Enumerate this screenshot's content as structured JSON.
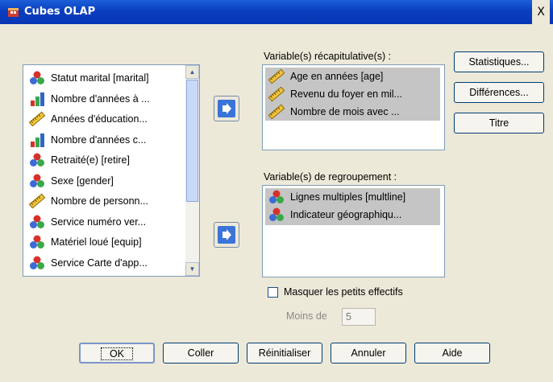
{
  "window": {
    "title": "Cubes OLAP",
    "close": "X"
  },
  "source_list": {
    "items": [
      {
        "label": "Statut marital [marital]",
        "icon": "nominal-icon"
      },
      {
        "label": "Nombre d'années à ...",
        "icon": "ordinal-icon"
      },
      {
        "label": "Années d'éducation...",
        "icon": "scale-icon"
      },
      {
        "label": "Nombre d'années c...",
        "icon": "ordinal-icon"
      },
      {
        "label": "Retraité(e) [retire]",
        "icon": "nominal-icon"
      },
      {
        "label": "Sexe [gender]",
        "icon": "nominal-icon"
      },
      {
        "label": "Nombre de personn...",
        "icon": "scale-icon"
      },
      {
        "label": "Service numéro ver...",
        "icon": "nominal-icon"
      },
      {
        "label": "Matériel loué [equip]",
        "icon": "nominal-icon"
      },
      {
        "label": "Service Carte d'app...",
        "icon": "nominal-icon"
      }
    ]
  },
  "summary": {
    "label": "Variable(s) récapitulative(s) :",
    "items": [
      {
        "label": "Age en années [age]",
        "icon": "scale-icon"
      },
      {
        "label": "Revenu du foyer en mil...",
        "icon": "scale-icon"
      },
      {
        "label": "Nombre de mois avec ...",
        "icon": "scale-icon"
      }
    ]
  },
  "grouping": {
    "label": "Variable(s) de regroupement :",
    "items": [
      {
        "label": "Lignes multiples [multline]",
        "icon": "nominal-icon"
      },
      {
        "label": "Indicateur géographiqu...",
        "icon": "nominal-icon"
      }
    ]
  },
  "side_buttons": {
    "statistics": "Statistiques...",
    "differences": "Différences...",
    "title": "Titre"
  },
  "hide_small": {
    "label": "Masquer les petits effectifs",
    "checked": false
  },
  "less_than": {
    "label": "Moins de",
    "value": "5"
  },
  "bottom_buttons": {
    "ok": "OK",
    "paste": "Coller",
    "reset": "Réinitialiser",
    "cancel": "Annuler",
    "help": "Aide"
  }
}
